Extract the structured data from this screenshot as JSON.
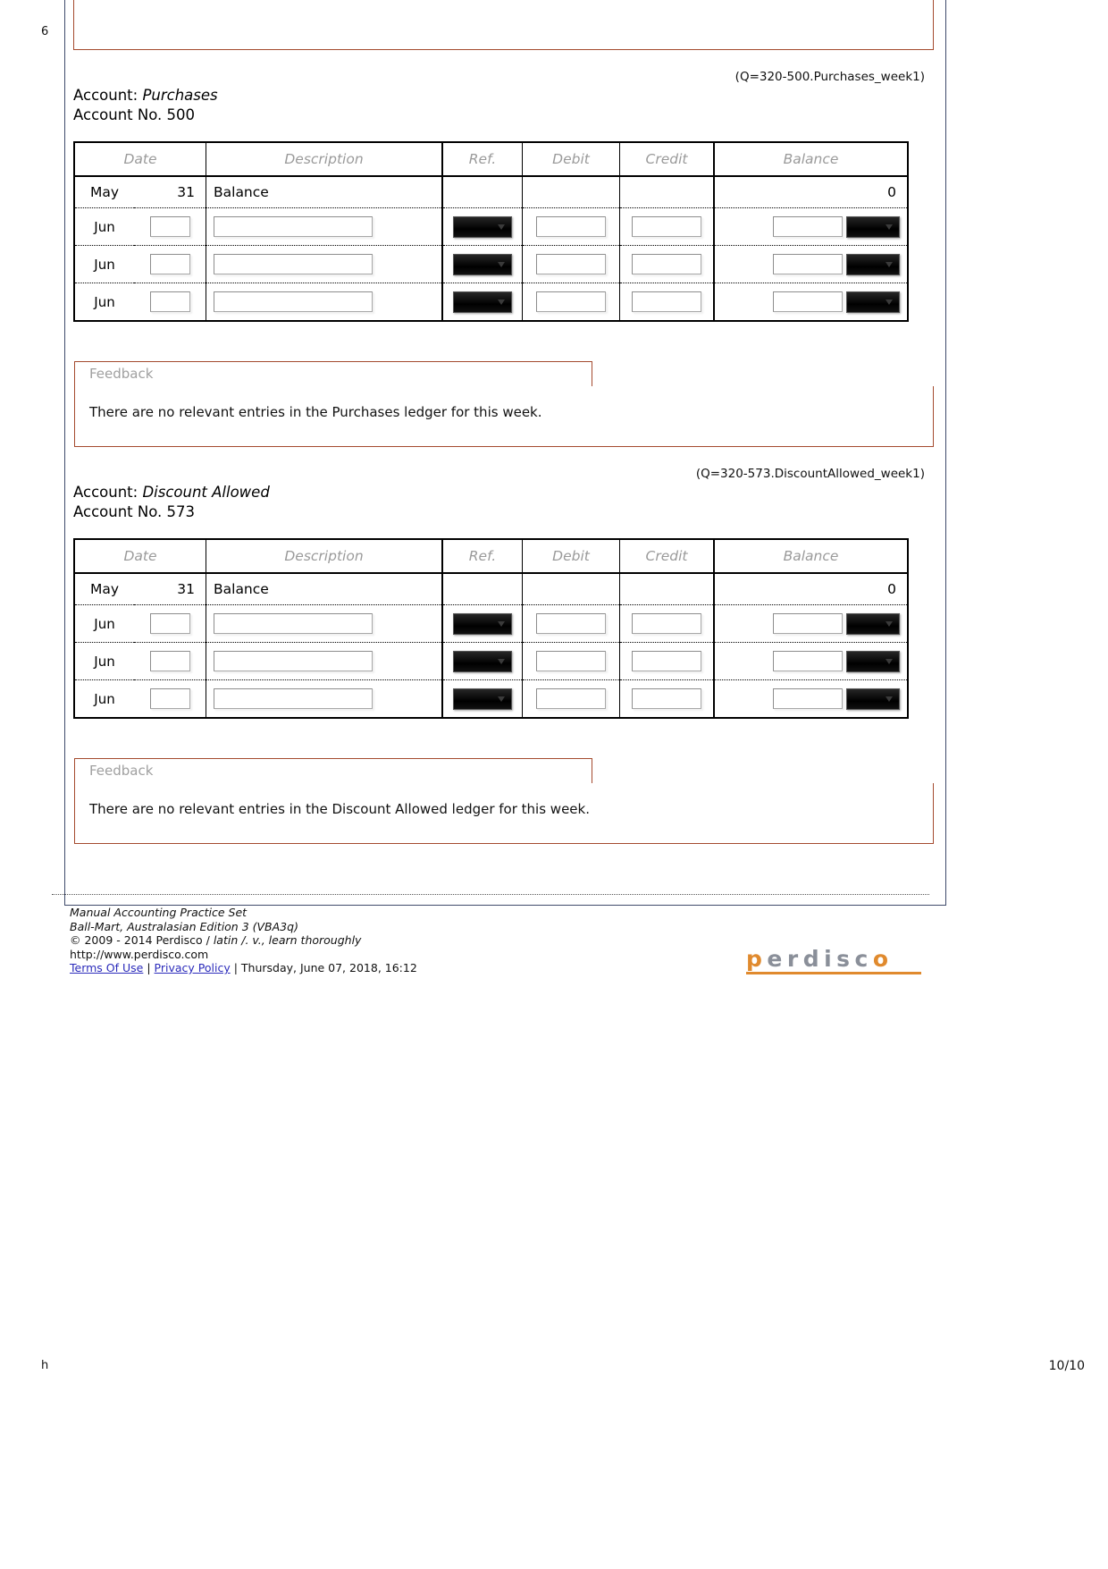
{
  "page": {
    "edge_left_top": "6",
    "edge_left_bottom": "h",
    "page_number": "10/10"
  },
  "table_headers": [
    "Date",
    "Description",
    "Ref.",
    "Debit",
    "Credit",
    "Balance"
  ],
  "sections": [
    {
      "qcode": "(Q=320-500.Purchases_week1)",
      "account_label": "Account:",
      "account_name": "Purchases",
      "account_no_label": "Account No. 500",
      "opening_row": {
        "month": "May",
        "day": "31",
        "description": "Balance",
        "ref": "",
        "debit": "",
        "credit": "",
        "balance": "0"
      },
      "entry_rows": [
        {
          "month": "Jun",
          "day": "",
          "description": "",
          "ref": "",
          "debit": "",
          "credit": "",
          "balance": ""
        },
        {
          "month": "Jun",
          "day": "",
          "description": "",
          "ref": "",
          "debit": "",
          "credit": "",
          "balance": ""
        },
        {
          "month": "Jun",
          "day": "",
          "description": "",
          "ref": "",
          "debit": "",
          "credit": "",
          "balance": ""
        }
      ],
      "feedback_tab": "Feedback",
      "feedback_text": "There are no relevant entries in the Purchases ledger for this week."
    },
    {
      "qcode": "(Q=320-573.DiscountAllowed_week1)",
      "account_label": "Account:",
      "account_name": "Discount Allowed",
      "account_no_label": "Account No. 573",
      "opening_row": {
        "month": "May",
        "day": "31",
        "description": "Balance",
        "ref": "",
        "debit": "",
        "credit": "",
        "balance": "0"
      },
      "entry_rows": [
        {
          "month": "Jun",
          "day": "",
          "description": "",
          "ref": "",
          "debit": "",
          "credit": "",
          "balance": ""
        },
        {
          "month": "Jun",
          "day": "",
          "description": "",
          "ref": "",
          "debit": "",
          "credit": "",
          "balance": ""
        },
        {
          "month": "Jun",
          "day": "",
          "description": "",
          "ref": "",
          "debit": "",
          "credit": "",
          "balance": ""
        }
      ],
      "feedback_tab": "Feedback",
      "feedback_text": "There are no relevant entries in the Discount Allowed ledger for this week."
    }
  ],
  "footer": {
    "line1": "Manual Accounting Practice Set",
    "line2": "Ball-Mart, Australasian Edition 3 (VBA3q)",
    "line3_a": "© 2009 - 2014 Perdisco / ",
    "line3_b": "latin /. v., learn thoroughly",
    "line4": "http://www.perdisco.com",
    "terms": "Terms Of Use",
    "sep1": " | ",
    "privacy": "Privacy Policy",
    "sep2": " | ",
    "timestamp": "Thursday, June 07, 2018, 16:12",
    "logo_text": "perdisc",
    "logo_text_o": "o",
    "logo_text_p": "p",
    "logo_text_mid": "erdisc"
  },
  "colors": {
    "feedback_border": "#a44a2e",
    "page_border": "#3f4a6b",
    "logo_orange": "#e08a2e",
    "logo_gray": "#8a8f99",
    "header_text": "#9a9a9a"
  }
}
